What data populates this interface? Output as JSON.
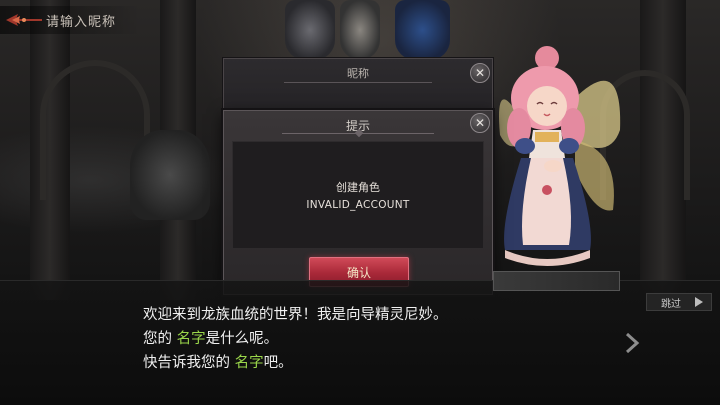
{
  "header": {
    "title": "请输入昵称"
  },
  "name_panel": {
    "title": "昵称"
  },
  "dialog": {
    "title": "提示",
    "message_line1": "创建角色",
    "message_line2": "INVALID_ACCOUNT",
    "confirm_label": "确认"
  },
  "dialogue": {
    "skip_label": "跳过",
    "line1": "欢迎来到龙族血统的世界！我是向导精灵尼妙。",
    "line2_prefix": "您的 ",
    "line2_highlight": "名字",
    "line2_suffix": "是什么呢。",
    "line3_prefix": "快告诉我您的 ",
    "line3_highlight": "名字",
    "line3_suffix": "吧。"
  },
  "colors": {
    "highlight": "#9ad64a",
    "confirm_button": "#a82838"
  },
  "icons": {
    "back": "dragon-ornament-icon",
    "close": "close-icon",
    "skip": "play-arrow-icon",
    "next": "chevron-right-icon"
  }
}
